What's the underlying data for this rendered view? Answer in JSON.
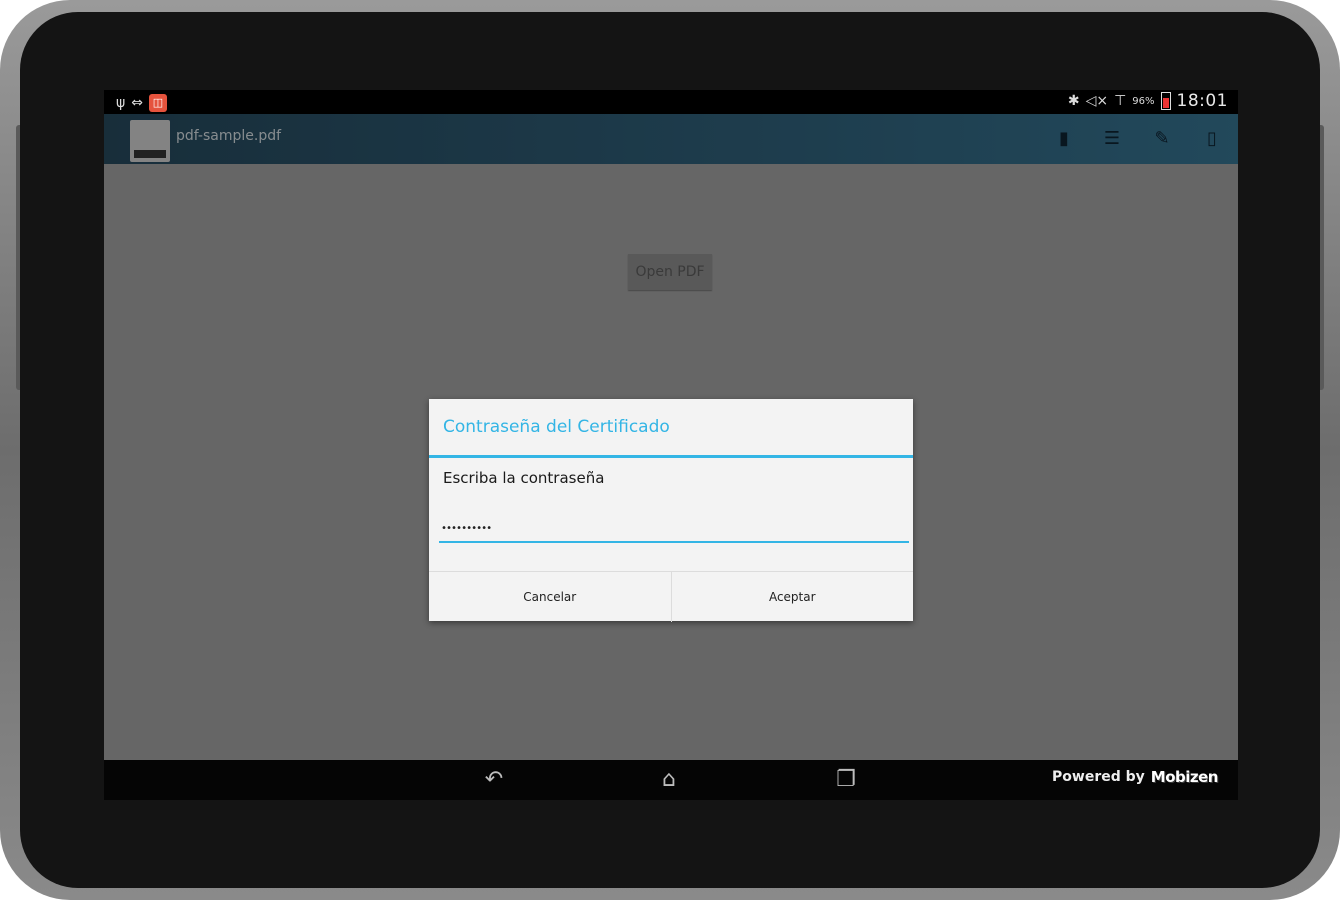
{
  "statusbar": {
    "left_icons": [
      "usb-icon",
      "sync-icon",
      "notification-icon"
    ],
    "right_icons": [
      "bluetooth-icon",
      "mute-icon",
      "wifi-icon",
      "battery-icon"
    ],
    "battery_percent": "96%",
    "time": "18:01"
  },
  "actionbar": {
    "title": "pdf-sample.pdf",
    "actions": [
      "document-icon",
      "list-icon",
      "edit-icon",
      "delete-icon"
    ]
  },
  "content": {
    "open_button_label": "Open PDF"
  },
  "dialog": {
    "title": "Contraseña del Certificado",
    "message": "Escriba la contraseña",
    "password_value": "••••••••••",
    "cancel_label": "Cancelar",
    "accept_label": "Aceptar"
  },
  "navbar": {
    "icons": [
      "back-icon",
      "home-icon",
      "recents-icon"
    ],
    "powered_label": "Powered by",
    "powered_brand": "Mobizen"
  },
  "colors": {
    "accent": "#33b5e5",
    "actionbar": "#2c5870",
    "overlay": "#666666"
  }
}
